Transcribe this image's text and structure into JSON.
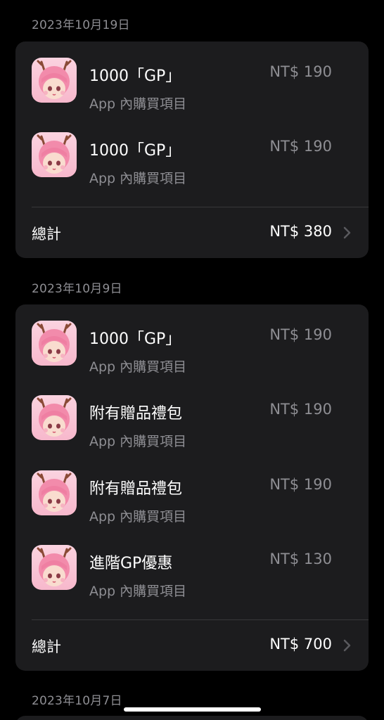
{
  "colors": {
    "background": "#000000",
    "card": "#1c1c1e",
    "secondary_text": "#8e8e93",
    "primary_text": "#ffffff",
    "divider": "#38383a"
  },
  "groups": [
    {
      "date": "2023年10月19日",
      "items": [
        {
          "name": "1000「GP」",
          "type": "App 內購買項目",
          "price": "NT$ 190",
          "icon": "pink-deer-girl-app-icon"
        },
        {
          "name": "1000「GP」",
          "type": "App 內購買項目",
          "price": "NT$ 190",
          "icon": "pink-deer-girl-app-icon"
        }
      ],
      "total_label": "總計",
      "total_amount": "NT$ 380"
    },
    {
      "date": "2023年10月9日",
      "items": [
        {
          "name": "1000「GP」",
          "type": "App 內購買項目",
          "price": "NT$ 190",
          "icon": "pink-deer-girl-app-icon"
        },
        {
          "name": "附有贈品禮包",
          "type": "App 內購買項目",
          "price": "NT$ 190",
          "icon": "pink-deer-girl-app-icon"
        },
        {
          "name": "附有贈品禮包",
          "type": "App 內購買項目",
          "price": "NT$ 190",
          "icon": "pink-deer-girl-app-icon"
        },
        {
          "name": "進階GP優惠",
          "type": "App 內購買項目",
          "price": "NT$ 130",
          "icon": "pink-deer-girl-app-icon"
        }
      ],
      "total_label": "總計",
      "total_amount": "NT$ 700"
    },
    {
      "date": "2023年10月7日"
    }
  ]
}
